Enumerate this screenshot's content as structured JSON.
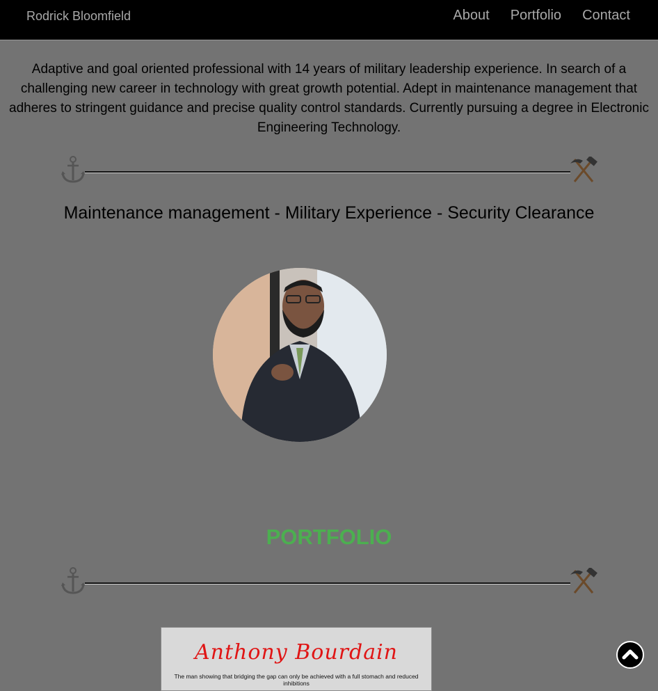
{
  "header": {
    "brand": "Rodrick Bloomfield",
    "nav": [
      {
        "label": "About"
      },
      {
        "label": "Portfolio"
      },
      {
        "label": "Contact"
      }
    ]
  },
  "about": {
    "intro": "Adaptive and goal oriented professional with 14 years of military leadership experience. In search of a challenging new career in technology with great growth potential. Adept in maintenance management that adheres to stringent guidance and precise quality control standards. Currently pursuing a degree in Electronic Engineering Technology.",
    "tagline": "Maintenance management - Military Experience - Security Clearance",
    "divider_left_icon": "anchor-icon",
    "divider_right_icon": "hammer-pick-icon",
    "photo": "profile-photo"
  },
  "portfolio": {
    "title": "PORTFOLIO",
    "cards": [
      {
        "title": "Anthony Bourdain",
        "description": "The man showing that bridging the gap can only be achieved with a full stomach and reduced inhibitions"
      }
    ]
  },
  "scroll_top_icon": "chevron-up-icon",
  "colors": {
    "background": "#737373",
    "navbar": "#000000",
    "nav_text": "#a9a9a9",
    "portfolio_title": "#4caf50",
    "card_title": "#e01515"
  }
}
